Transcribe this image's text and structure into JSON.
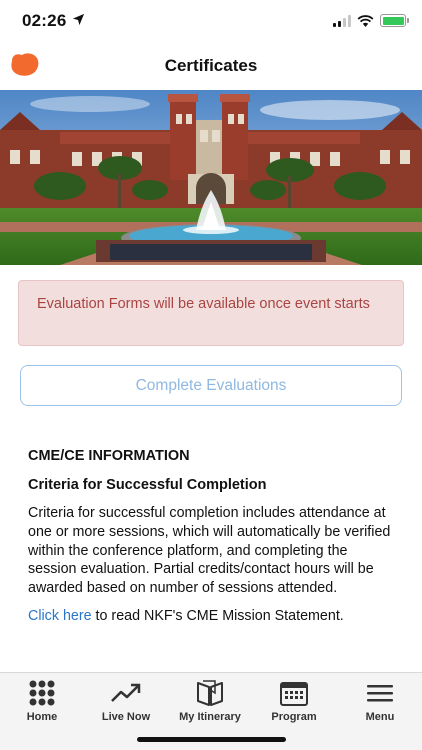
{
  "status_bar": {
    "time": "02:26"
  },
  "header": {
    "title": "Certificates"
  },
  "alert": {
    "text": "Evaluation Forms will be available once event starts"
  },
  "evaluations": {
    "button_label": "Complete Evaluations"
  },
  "cme": {
    "heading": "CME/CE INFORMATION",
    "subheading": "Criteria for Successful Completion",
    "body": "Criteria for successful completion includes attendance at one or more sessions, which will automatically be verified within the conference platform, and completing the session evaluation. Partial credits/contact hours will be awarded based on number of sessions attended.",
    "link_text": "Click here",
    "link_suffix": " to read NKF's CME Mission Statement."
  },
  "tabs": [
    {
      "label": "Home",
      "icon": "grid-dots-icon"
    },
    {
      "label": "Live Now",
      "icon": "trend-arrow-icon"
    },
    {
      "label": "My Itinerary",
      "icon": "book-open-icon"
    },
    {
      "label": "Program",
      "icon": "calendar-icon"
    },
    {
      "label": "Menu",
      "icon": "hamburger-icon"
    }
  ],
  "colors": {
    "alert_bg": "#f3dede",
    "alert_text": "#a94442",
    "button_border": "#9ec3e8",
    "link": "#2a77c9",
    "logo": "#f26a2e",
    "battery": "#34c759"
  }
}
